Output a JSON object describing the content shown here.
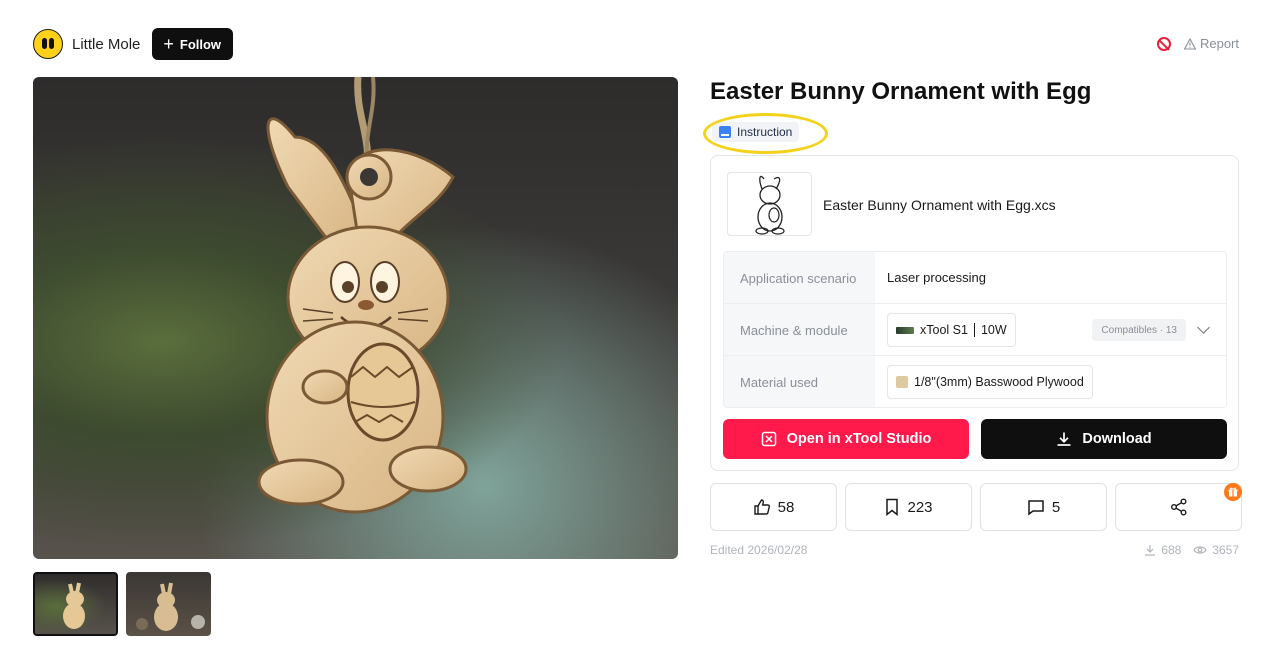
{
  "author": {
    "name": "Little Mole",
    "follow_label": "Follow"
  },
  "report": {
    "label": "Report"
  },
  "project": {
    "title": "Easter Bunny Ornament with Egg",
    "instruction_label": "Instruction",
    "file_name": "Easter Bunny Ornament with Egg.xcs"
  },
  "specs": {
    "scenario_label": "Application scenario",
    "scenario_value": "Laser processing",
    "machine_label": "Machine & module",
    "machine_name": "xTool S1",
    "machine_module": "10W",
    "compatibles": "Compatibles · 13",
    "material_label": "Material used",
    "material_value": "1/8\"(3mm) Basswood Plywood"
  },
  "buttons": {
    "open_label": "Open in xTool Studio",
    "download_label": "Download"
  },
  "actions": {
    "likes": "58",
    "saves": "223",
    "comments": "5"
  },
  "meta": {
    "edited": "Edited 2026/02/28",
    "downloads": "688",
    "views": "3657"
  },
  "colors": {
    "primary_red": "#ff1a4b",
    "dark": "#0f0f10",
    "highlight": "#f5d219"
  },
  "icons": [
    "plus-icon",
    "block-icon",
    "warning-icon",
    "doc-icon",
    "machine-icon",
    "chevron-down-icon",
    "open-studio-icon",
    "download-icon",
    "thumbs-up-icon",
    "bookmark-icon",
    "comment-icon",
    "share-icon",
    "gift-icon",
    "eye-icon"
  ]
}
